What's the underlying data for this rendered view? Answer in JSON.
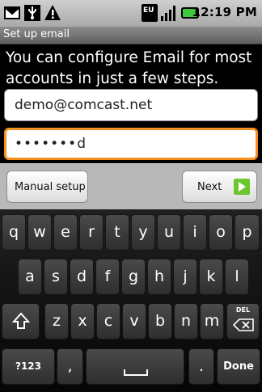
{
  "status": {
    "time": "12:19 PM",
    "network_badge": "EU"
  },
  "screen": {
    "title": "Set up email",
    "instructions": "You can configure Email for most accounts in just a few steps."
  },
  "form": {
    "email_value": "demo@comcast.net",
    "password_value": "•••••••d"
  },
  "actions": {
    "manual_setup_label": "Manual setup",
    "next_label": "Next"
  },
  "keyboard": {
    "row1": [
      "q",
      "w",
      "e",
      "r",
      "t",
      "y",
      "u",
      "i",
      "o",
      "p"
    ],
    "row2": [
      "a",
      "s",
      "d",
      "f",
      "g",
      "h",
      "j",
      "k",
      "l"
    ],
    "row3": [
      "z",
      "x",
      "c",
      "v",
      "b",
      "n",
      "m"
    ],
    "symbols_label": "?123",
    "comma_label": ",",
    "period_label": ".",
    "done_label": "Done",
    "delete_label": "DEL"
  },
  "colors": {
    "focus_border": "#f5901e",
    "next_icon": "#6cc62e",
    "battery": "#3ec93e"
  }
}
